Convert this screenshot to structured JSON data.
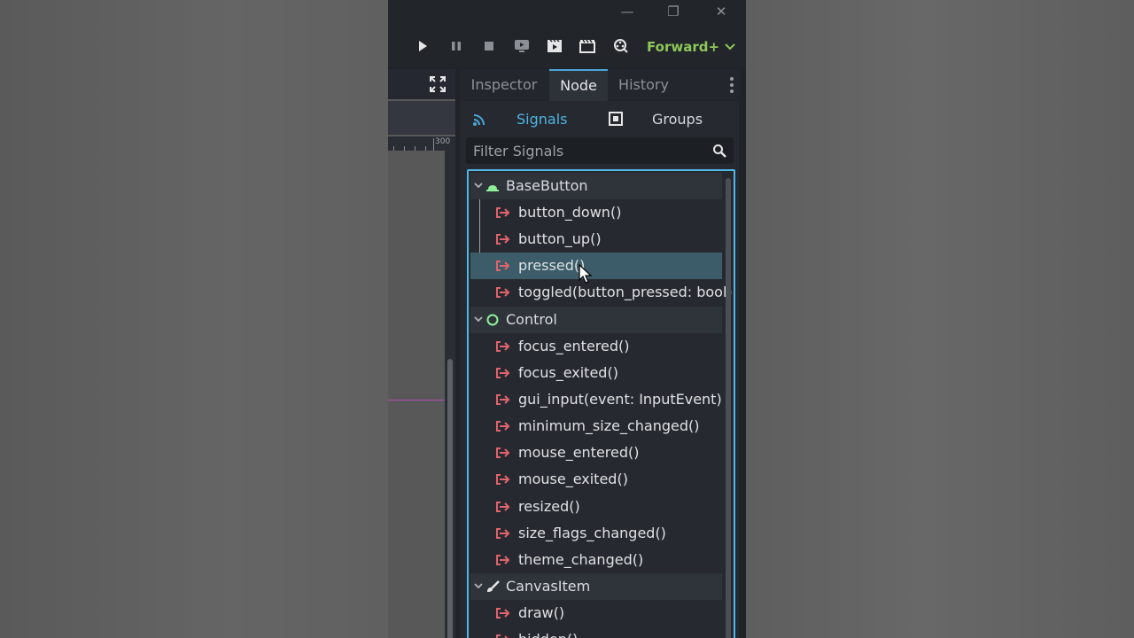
{
  "window": {
    "minimize_glyph": "—",
    "restore_glyph": "❐",
    "close_glyph": "✕"
  },
  "toolbar": {
    "icons": [
      "play-icon",
      "pause-icon",
      "stop-icon",
      "remote-debug-icon",
      "play-scene-icon",
      "play-custom-scene-icon",
      "movie-maker-icon"
    ],
    "renderer": "Forward+",
    "renderer_color": "#8ec75a"
  },
  "viewport": {
    "ruler_label": "300",
    "guide_color": "#b34ab5"
  },
  "dock": {
    "tabs": [
      {
        "label": "Inspector",
        "active": false
      },
      {
        "label": "Node",
        "active": true
      },
      {
        "label": "History",
        "active": false
      }
    ],
    "subtabs": {
      "signals": "Signals",
      "groups": "Groups"
    },
    "filter": {
      "placeholder": "Filter Signals",
      "value": ""
    },
    "accent_color": "#4fb8e6",
    "signal_icon_color": "#e0636d"
  },
  "signal_tree": [
    {
      "type": "category",
      "label": "BaseButton",
      "icon": "base-button-icon"
    },
    {
      "type": "signal",
      "label": "button_down()"
    },
    {
      "type": "signal",
      "label": "button_up()"
    },
    {
      "type": "signal",
      "label": "pressed()",
      "selected": true
    },
    {
      "type": "signal",
      "label": "toggled(button_pressed: bool)"
    },
    {
      "type": "category",
      "label": "Control",
      "icon": "control-icon"
    },
    {
      "type": "signal",
      "label": "focus_entered()"
    },
    {
      "type": "signal",
      "label": "focus_exited()"
    },
    {
      "type": "signal",
      "label": "gui_input(event: InputEvent)"
    },
    {
      "type": "signal",
      "label": "minimum_size_changed()"
    },
    {
      "type": "signal",
      "label": "mouse_entered()"
    },
    {
      "type": "signal",
      "label": "mouse_exited()"
    },
    {
      "type": "signal",
      "label": "resized()"
    },
    {
      "type": "signal",
      "label": "size_flags_changed()"
    },
    {
      "type": "signal",
      "label": "theme_changed()"
    },
    {
      "type": "category",
      "label": "CanvasItem",
      "icon": "canvas-item-icon"
    },
    {
      "type": "signal",
      "label": "draw()"
    },
    {
      "type": "signal",
      "label": "hidden()"
    }
  ]
}
